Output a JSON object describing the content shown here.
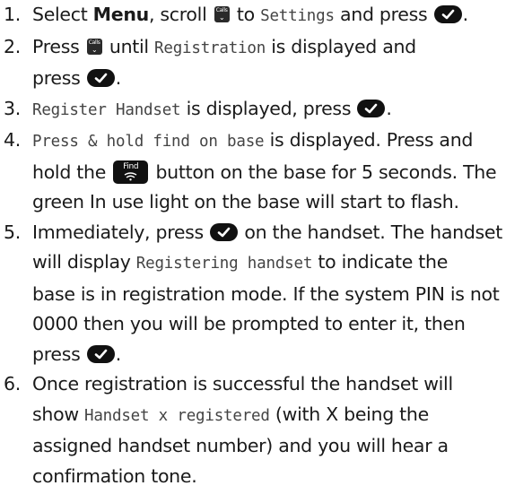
{
  "steps": [
    {
      "number": "1.",
      "select": "Select ",
      "menu": "Menu",
      "scroll": ", scroll ",
      "calls_icon": "Calls",
      "to": " to ",
      "settings_lcd": "Settings",
      "and_press": " and press ",
      "end": "."
    },
    {
      "number": "2.",
      "press": "Press ",
      "calls_icon": "Calls",
      "until": " until ",
      "registration_lcd": "Registration",
      "is_displayed": " is displayed and",
      "press2": "press ",
      "end": "."
    },
    {
      "number": "3.",
      "register_lcd": "Register Handset",
      "is_displayed_press": " is displayed, press ",
      "end": "."
    },
    {
      "number": "4.",
      "press_hold_lcd": "Press & hold find on base",
      "text_a": " is displayed. Press and",
      "hold_the": "hold the ",
      "find_icon": "Find",
      "text_b": " button on the base for 5 seconds. The",
      "text_c": "green In use light on the base will start to flash."
    },
    {
      "number": "5.",
      "immediately": "Immediately, press ",
      "on_handset": " on the handset. The handset",
      "will_display": "will display ",
      "registering_lcd": "Registering handset",
      "to_indicate": " to indicate the",
      "base_is": "base is in registration mode. If the system PIN is not",
      "pin_line": "0000 then you will be prompted to enter it, then",
      "press": "press ",
      "end": "."
    },
    {
      "number": "6.",
      "line1": "Once registration is successful the handset will",
      "show": "show ",
      "registered_lcd": "Handset x registered",
      "with_x": " (with X being the",
      "line3": "assigned handset number) and you will hear a",
      "line4": "confirmation tone."
    }
  ],
  "icons": {
    "ok_key": "check-icon",
    "scroll_key": "calls-scroll-icon",
    "find_key": "find-icon"
  },
  "colors": {
    "text": "#1a1a1a",
    "display_text": "#444444",
    "key_background": "#111111"
  }
}
